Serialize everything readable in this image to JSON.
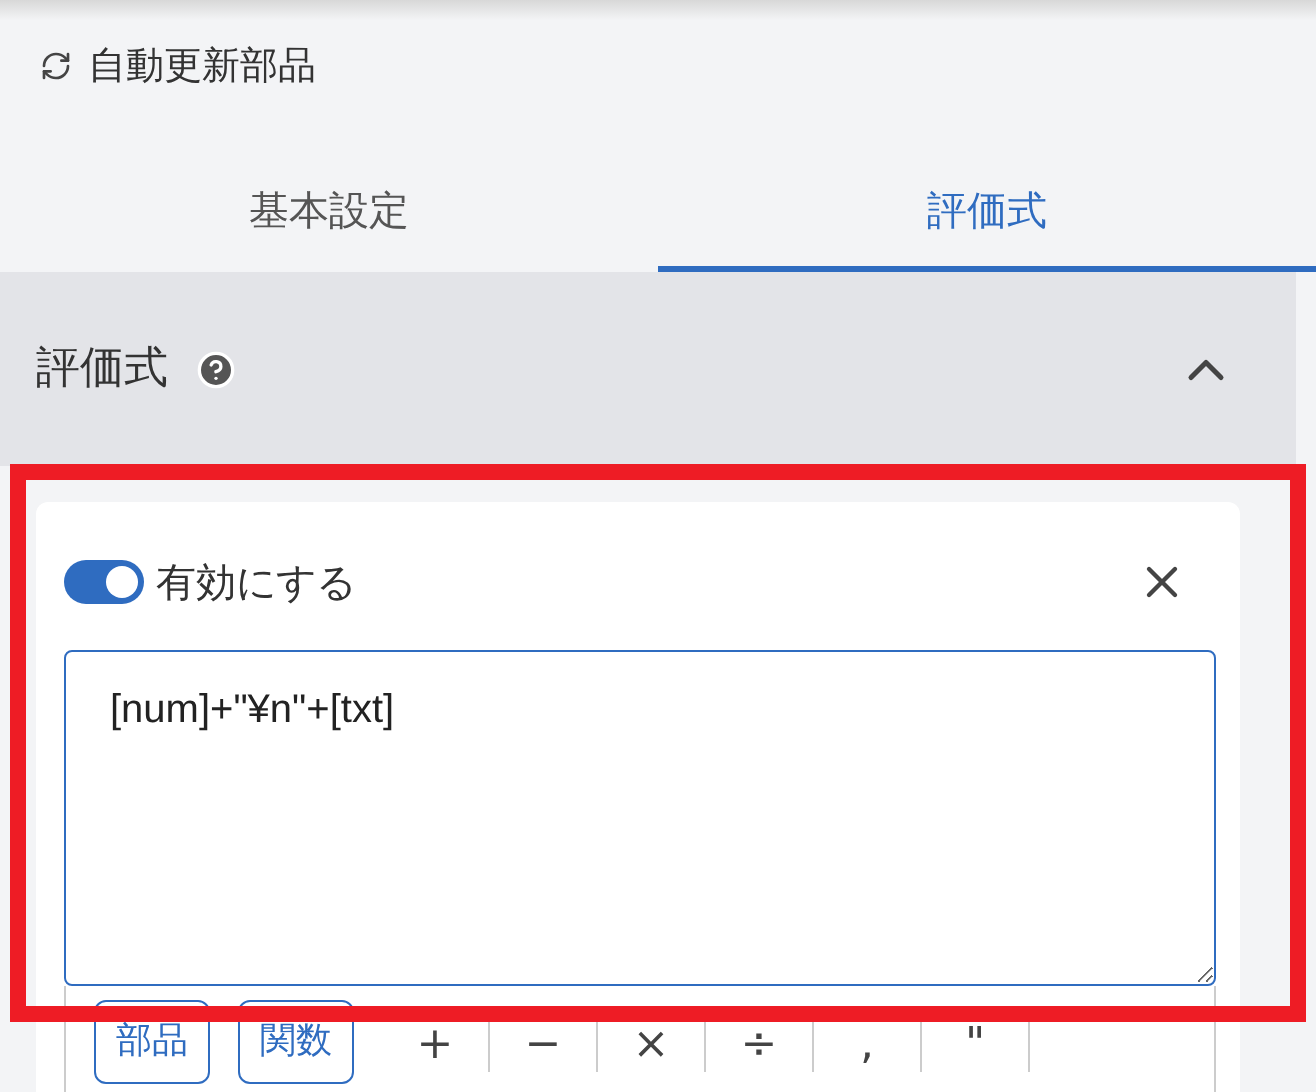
{
  "header": {
    "title": "自動更新部品"
  },
  "tabs": [
    {
      "label": "基本設定",
      "selected": false
    },
    {
      "label": "評価式",
      "selected": true
    }
  ],
  "section": {
    "title": "評価式",
    "expanded": true
  },
  "rule": {
    "enabled": true,
    "toggle_label": "有効にする",
    "expression": "[num]+\"¥n\"+[txt]"
  },
  "toolbar": [
    {
      "kind": "button",
      "label": "部品"
    },
    {
      "kind": "button",
      "label": "関数"
    },
    {
      "kind": "operator",
      "label": "+"
    },
    {
      "kind": "operator",
      "label": "−"
    },
    {
      "kind": "operator",
      "label": "×"
    },
    {
      "kind": "operator",
      "label": "÷"
    },
    {
      "kind": "operator",
      "label": ","
    },
    {
      "kind": "operator",
      "label": "\""
    }
  ]
}
